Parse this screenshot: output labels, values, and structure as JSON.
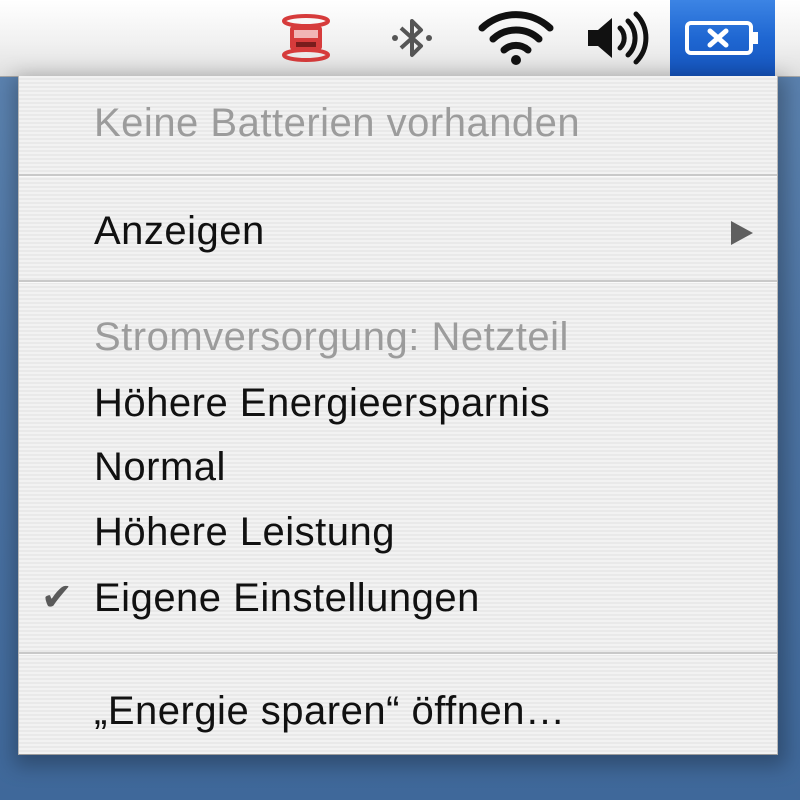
{
  "menubar": {
    "icons": [
      {
        "name": "sync-icon"
      },
      {
        "name": "bluetooth-icon"
      },
      {
        "name": "wifi-icon"
      },
      {
        "name": "volume-icon"
      },
      {
        "name": "battery-icon",
        "state": "no-battery",
        "accent": "#1f67d2"
      }
    ]
  },
  "menu": {
    "status": "Keine Batterien vorhanden",
    "show_label": "Anzeigen",
    "power_source": "Stromversorgung: Netzteil",
    "options": [
      {
        "label": "Höhere Energieersparnis",
        "checked": false
      },
      {
        "label": "Normal",
        "checked": false
      },
      {
        "label": "Höhere Leistung",
        "checked": false
      },
      {
        "label": "Eigene Einstellungen",
        "checked": true
      }
    ],
    "check_mark": "✔",
    "open_prefs": "„Energie sparen“ öffnen…"
  },
  "colors": {
    "disabled_text": "#9c9c9c",
    "text": "#111111",
    "selection_blue": "#1f67d2",
    "desktop": "#4d74a3",
    "sync_red": "#d63b3b"
  }
}
